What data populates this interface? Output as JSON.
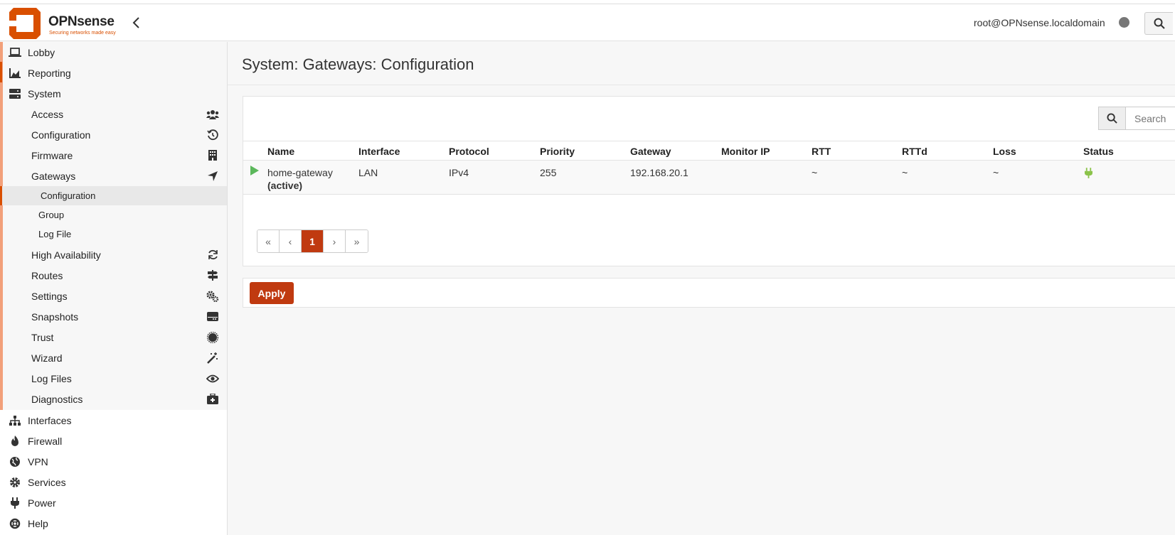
{
  "brand": {
    "name": "OPNsense",
    "tagline": "Securing networks made easy",
    "color": "#d94f00"
  },
  "header": {
    "user": "root@OPNsense.localdomain",
    "search_icon": "search-icon"
  },
  "sidebar": {
    "top_items": [
      {
        "label": "Lobby",
        "icon": "laptop-icon"
      },
      {
        "label": "Reporting",
        "icon": "area-chart-icon"
      },
      {
        "label": "System",
        "icon": "server-icon"
      }
    ],
    "system_items": [
      {
        "label": "Access",
        "icon": "users-icon"
      },
      {
        "label": "Configuration",
        "icon": "history-icon"
      },
      {
        "label": "Firmware",
        "icon": "building-icon"
      },
      {
        "label": "Gateways",
        "icon": "location-arrow-icon"
      }
    ],
    "gateway_sub": [
      {
        "label": "Configuration"
      },
      {
        "label": "Group"
      },
      {
        "label": "Log File"
      }
    ],
    "system_items_2": [
      {
        "label": "High Availability",
        "icon": "refresh-icon"
      },
      {
        "label": "Routes",
        "icon": "map-signs-icon"
      },
      {
        "label": "Settings",
        "icon": "cogs-icon"
      },
      {
        "label": "Snapshots",
        "icon": "hdd-icon"
      },
      {
        "label": "Trust",
        "icon": "certificate-icon"
      },
      {
        "label": "Wizard",
        "icon": "magic-icon"
      },
      {
        "label": "Log Files",
        "icon": "eye-icon"
      },
      {
        "label": "Diagnostics",
        "icon": "medkit-icon"
      }
    ],
    "bottom_items": [
      {
        "label": "Interfaces",
        "icon": "sitemap-icon"
      },
      {
        "label": "Firewall",
        "icon": "fire-icon"
      },
      {
        "label": "VPN",
        "icon": "globe-icon"
      },
      {
        "label": "Services",
        "icon": "cog-icon"
      },
      {
        "label": "Power",
        "icon": "plug-icon"
      },
      {
        "label": "Help",
        "icon": "life-ring-icon"
      }
    ]
  },
  "page": {
    "title": "System: Gateways: Configuration"
  },
  "search": {
    "placeholder": "Search"
  },
  "table": {
    "columns": [
      "Name",
      "Interface",
      "Protocol",
      "Priority",
      "Gateway",
      "Monitor IP",
      "RTT",
      "RTTd",
      "Loss",
      "Status"
    ],
    "rows": [
      {
        "name": "home-gateway",
        "name_suffix": "(active)",
        "interface": "LAN",
        "protocol": "IPv4",
        "priority": "255",
        "gateway": "192.168.20.1",
        "monitor_ip": "",
        "rtt": "~",
        "rttd": "~",
        "loss": "~",
        "status_icon": "plug-icon",
        "status_color": "#8bc34a"
      }
    ]
  },
  "pager": {
    "first": "«",
    "prev": "‹",
    "current": "1",
    "next": "›",
    "last": "»"
  },
  "actions": {
    "apply": "Apply"
  }
}
